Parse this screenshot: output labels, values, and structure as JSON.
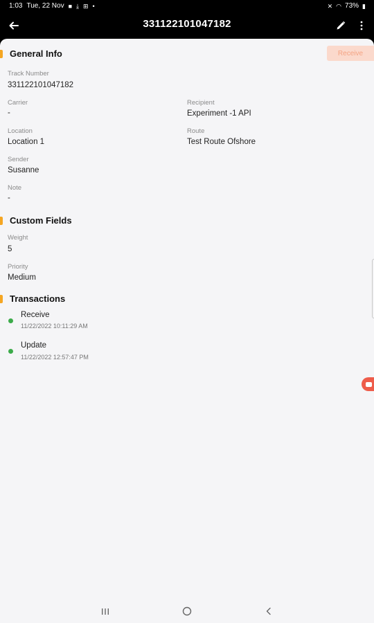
{
  "status_bar": {
    "time": "1:03",
    "date": "Tue, 22 Nov",
    "battery": "73%"
  },
  "app_bar": {
    "title": "331122101047182"
  },
  "general_info": {
    "heading": "General Info",
    "action_label": "Receive",
    "fields": {
      "track_number": {
        "label": "Track Number",
        "value": "331122101047182"
      },
      "carrier": {
        "label": "Carrier",
        "value": "-"
      },
      "recipient": {
        "label": "Recipient",
        "value": "Experiment -1 API"
      },
      "location": {
        "label": "Location",
        "value": "Location 1"
      },
      "route": {
        "label": "Route",
        "value": "Test Route Ofshore"
      },
      "sender": {
        "label": "Sender",
        "value": "Susanne"
      },
      "note": {
        "label": "Note",
        "value": "-"
      }
    }
  },
  "custom_fields": {
    "heading": "Custom Fields",
    "weight": {
      "label": "Weight",
      "value": "5"
    },
    "priority": {
      "label": "Priority",
      "value": "Medium"
    }
  },
  "transactions": {
    "heading": "Transactions",
    "items": [
      {
        "name": "Receive",
        "time": "11/22/2022 10:11:29 AM"
      },
      {
        "name": "Update",
        "time": "11/22/2022 12:57:47 PM"
      }
    ]
  },
  "colors": {
    "accent": "#f5a623",
    "status_dot": "#3cab4a",
    "receive_bg": "#fbd9cc",
    "receive_text": "#f4a383"
  },
  "icons": [
    "back-arrow-icon",
    "edit-pencil-icon",
    "more-vert-icon",
    "recent-apps-icon",
    "home-icon",
    "back-nav-icon"
  ]
}
